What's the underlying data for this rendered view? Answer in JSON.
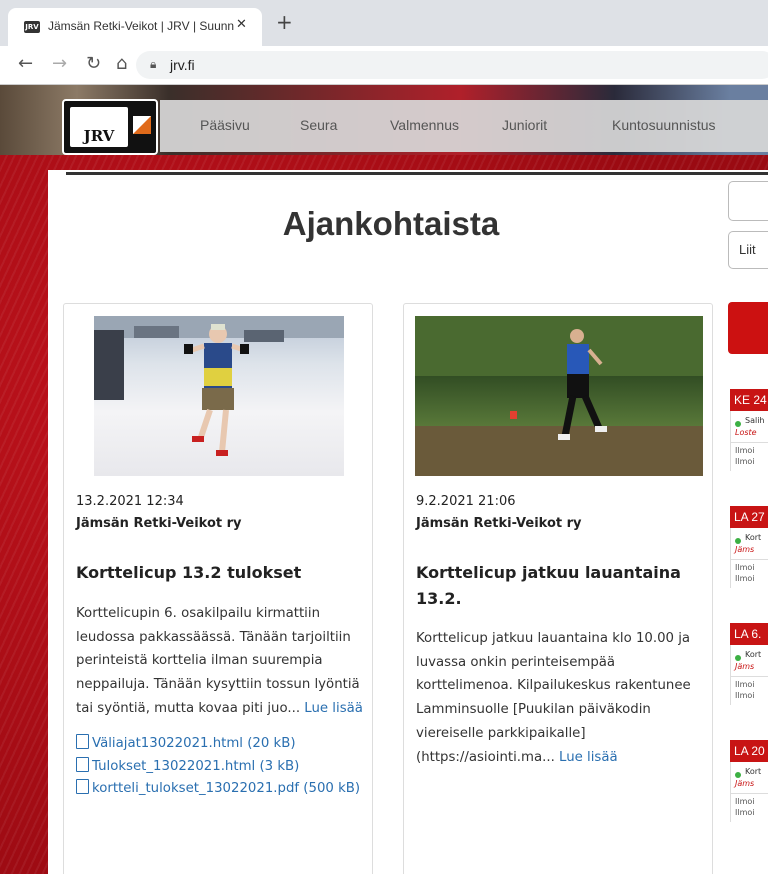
{
  "browser": {
    "tab_title": "Jämsän Retki-Veikot | JRV | Suunn",
    "favicon": "JRV",
    "url": "jrv.fi"
  },
  "site": {
    "logo_text": "JRV",
    "menu": [
      "Pääsivu",
      "Seura",
      "Valmennus",
      "Juniorit",
      "Kuntosuunnistus"
    ],
    "heading": "Ajankohtaista",
    "side_input_text": "Liit"
  },
  "news": [
    {
      "date": "13.2.2021 12:34",
      "author": "Jämsän Retki-Veikot ry",
      "title": "Korttelicup 13.2 tulokset",
      "text": "Korttelicupin 6. osakilpailu kirmattiin leudossa pakkassäässä. Tänään tarjoiltiin perinteistä korttelia ilman suurempia neppailuja. Tänään kysyttiin tossun lyöntiä tai syöntiä, mutta kovaa piti juo...",
      "more": "Lue lisää",
      "files": [
        "Väliajat13022021.html (20 kB)",
        "Tulokset_13022021.html (3 kB)",
        "kortteli_tulokset_13022021.pdf (500 kB)"
      ]
    },
    {
      "date": "9.2.2021 21:06",
      "author": "Jämsän Retki-Veikot ry",
      "title": "Korttelicup jatkuu lauantaina 13.2.",
      "text": "Korttelicup jatkuu lauantaina klo 10.00 ja luvassa onkin perinteisempää korttelimenoa. Kilpailukeskus rakentunee Lamminsuolle [Puukilan päiväkodin viereiselle parkkipaikalle](https://asiointi.ma...",
      "more": "Lue lisää"
    }
  ],
  "calendar": [
    {
      "head": "KE 24",
      "name": "Salih",
      "loc": "Loste",
      "l1": "Ilmoi",
      "l2": "Ilmoi"
    },
    {
      "head": "LA 27",
      "name": "Kort",
      "loc": "Jäms",
      "l1": "Ilmoi",
      "l2": "Ilmoi"
    },
    {
      "head": "LA 6.",
      "name": "Kort",
      "loc": "Jäms",
      "l1": "Ilmoi",
      "l2": "Ilmoi"
    },
    {
      "head": "LA 20",
      "name": "Kort",
      "loc": "Jäms",
      "l1": "Ilmoi",
      "l2": "Ilmoi"
    }
  ]
}
